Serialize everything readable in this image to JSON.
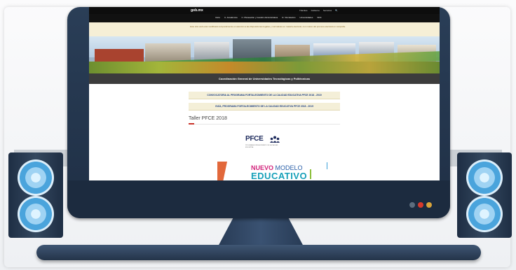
{
  "gob": {
    "logo": "gob.mx",
    "links": [
      "Trámites",
      "Gobierno",
      "Servicios",
      "🔍"
    ]
  },
  "subnav": {
    "items": [
      "Inicio",
      "C. Académica",
      "C. Planeación y Gestión Administrativa",
      "D. Vinculación",
      "Universidades",
      "SNC"
    ]
  },
  "notice": {
    "text": "Este sitio web está modificado temporalmente en atención a las disposiciones legales y normativas en materia electoral, con motivo del proceso electoral en campaña."
  },
  "banner": {
    "alt": "Campus universitarios"
  },
  "header": {
    "title": "Coordinación General de Universidades Tecnológicas y Politécnicas"
  },
  "links": {
    "convocatoria": "CONVOCATORIA AL PROGRAMA FORTALECIMIENTO DE LA CALIDAD EDUCATIVA PFCE 2018 - 2019",
    "guia": "GUÍA, PROGRAMA FORTALECIMIENTO DE LA CALIDAD EDUCATIVA PFCE 2018 - 2019"
  },
  "section": {
    "title": "Taller PFCE 2018"
  },
  "pfce": {
    "logo": "PFCE",
    "subtitle": "PROGRAMA FORTALECIMIENTO DE LA CALIDAD EDUCATIVA"
  },
  "nme": {
    "nuevo": "NUEVO",
    "modelo": "MODELO",
    "educativo": "EDUCATIVO"
  },
  "colors": {
    "accent": "#c9332a",
    "link": "#1c3f85",
    "monitor": "#1f2f45"
  }
}
